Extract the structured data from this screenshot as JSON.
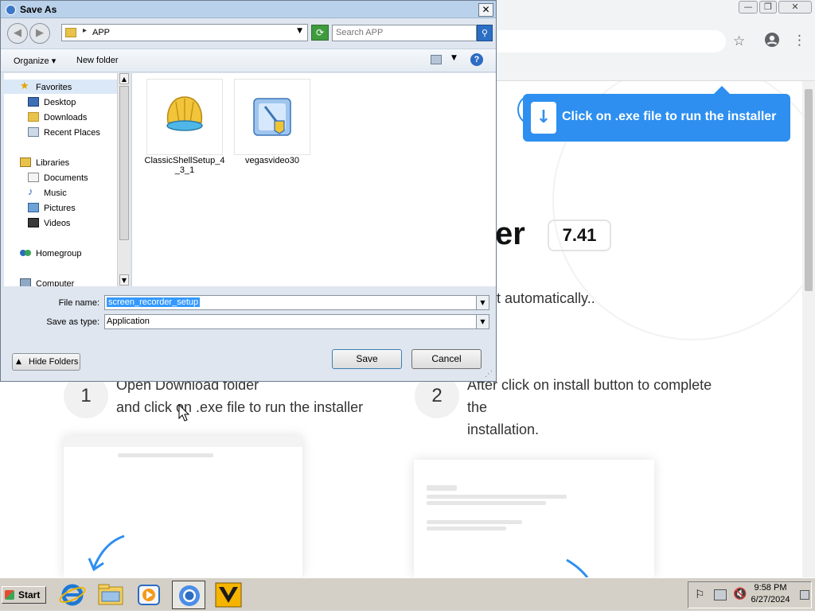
{
  "browser": {
    "window_controls": [
      "—",
      "❐",
      "✕"
    ],
    "tooltip_text": "Click on .exe file to run the installer",
    "heading_partial": "er",
    "version": "7.41",
    "auto_text": "t automatically..",
    "steps": [
      {
        "num": "1",
        "line1": "Open Download folder",
        "line2": "and click on .exe file to run the installer"
      },
      {
        "num": "2",
        "line1": "After click on install button to complete",
        "line2": "the",
        "line3": "installation."
      }
    ]
  },
  "dialog": {
    "title": "Save As",
    "close_label": "✕",
    "address_path": "APP",
    "search_placeholder": "Search APP",
    "toolbar": {
      "organize": "Organize ▾",
      "new_folder": "New folder"
    },
    "nav": {
      "favorites": "Favorites",
      "desktop": "Desktop",
      "downloads": "Downloads",
      "recent": "Recent Places",
      "libraries": "Libraries",
      "documents": "Documents",
      "music": "Music",
      "pictures": "Pictures",
      "videos": "Videos",
      "homegroup": "Homegroup",
      "computer": "Computer"
    },
    "files": [
      {
        "name_line1": "ClassicShellSetup_4",
        "name_line2": "_3_1",
        "icon": "shell-setup-icon"
      },
      {
        "name_line1": "vegasvideo30",
        "name_line2": "",
        "icon": "installer-icon"
      }
    ],
    "file_name_label": "File name:",
    "file_name_value": "screen_recorder_setup",
    "save_type_label": "Save as type:",
    "save_type_value": "Application",
    "save_button": "Save",
    "cancel_button": "Cancel",
    "hide_folders": "Hide Folders"
  },
  "taskbar": {
    "start": "Start",
    "apps": [
      "internet-explorer-icon",
      "file-explorer-icon",
      "media-player-icon",
      "chrome-icon",
      "vegas-icon"
    ],
    "time": "9:58 PM",
    "date": "6/27/2024"
  },
  "colors": {
    "accent": "#2e8ff0",
    "dialog_bg": "#dfe6ef",
    "title_bg": "#b9d1ea"
  }
}
